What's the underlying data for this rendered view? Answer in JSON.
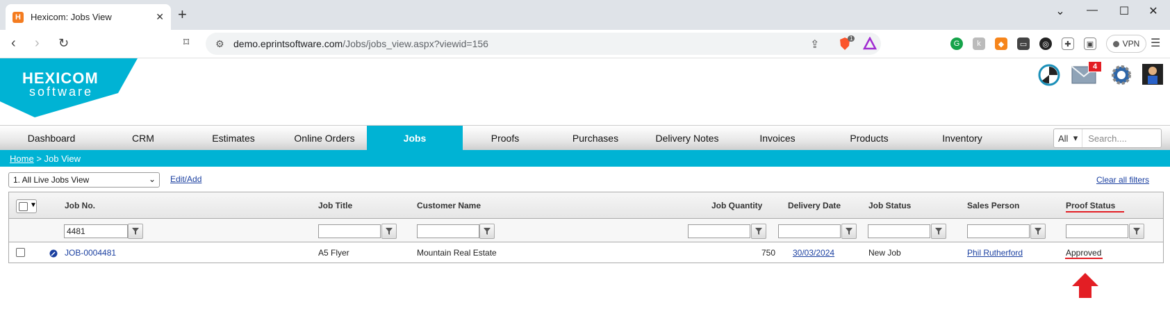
{
  "browser": {
    "tab_title": "Hexicom: Jobs View",
    "tab_favicon": "H",
    "url_host": "demo.eprintsoftware.com",
    "url_path": "/Jobs/jobs_view.aspx?viewid=156",
    "vpn_label": "VPN",
    "extension_badge": "1"
  },
  "logo": {
    "line1": "HEXICOM",
    "line2": "software"
  },
  "header": {
    "mail_badge": "4"
  },
  "nav": {
    "items": [
      "Dashboard",
      "CRM",
      "Estimates",
      "Online Orders",
      "Jobs",
      "Proofs",
      "Purchases",
      "Delivery Notes",
      "Invoices",
      "Products",
      "Inventory"
    ],
    "active": "Jobs",
    "search_scope": "All",
    "search_placeholder": "Search...."
  },
  "breadcrumb": {
    "home": "Home",
    "separator": ">",
    "current": "Job View"
  },
  "toolbar": {
    "view_selected": "1. All Live Jobs View",
    "edit_add": "Edit/Add",
    "clear_filters": "Clear all filters"
  },
  "grid": {
    "columns": [
      "Job No.",
      "Job Title",
      "Customer Name",
      "Job Quantity",
      "Delivery Date",
      "Job Status",
      "Sales Person",
      "Proof Status"
    ],
    "filters": {
      "job_no": "4481"
    },
    "rows": [
      {
        "job_no": "JOB-0004481",
        "job_title": "A5 Flyer",
        "customer_name": "Mountain Real Estate",
        "job_quantity": "750",
        "delivery_date": "30/03/2024",
        "job_status": "New Job",
        "sales_person": "Phil Rutherford",
        "proof_status": "Approved"
      }
    ]
  },
  "colors": {
    "accent": "#00b3d4",
    "annotation": "#e31e24",
    "link": "#1a3fa0"
  }
}
